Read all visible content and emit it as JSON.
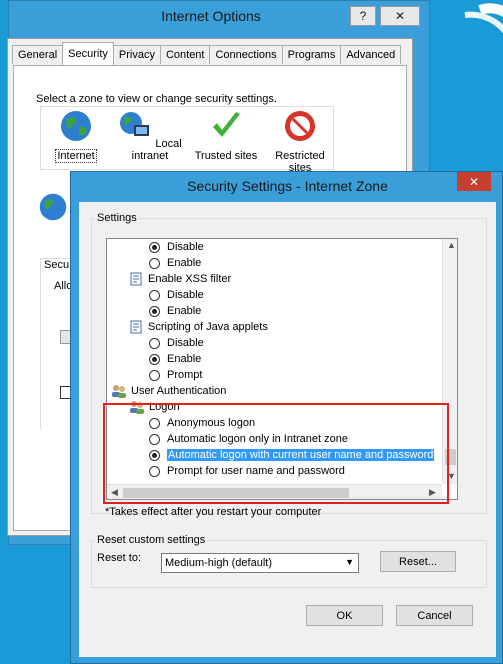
{
  "internet_options": {
    "title": "Internet Options",
    "help_btn": "?",
    "close_btn": "✕",
    "tabs": [
      "General",
      "Security",
      "Privacy",
      "Content",
      "Connections",
      "Programs",
      "Advanced"
    ],
    "zone_prompt": "Select a zone to view or change security settings.",
    "zones": [
      {
        "label": "Internet"
      },
      {
        "label": "Local intranet"
      },
      {
        "label": "Trusted sites"
      },
      {
        "label": "Restricted\nsites"
      }
    ],
    "partial_secu": "Secu",
    "partial_allo": "Allo"
  },
  "security_settings": {
    "title": "Security Settings - Internet Zone",
    "close_btn": "✕",
    "settings_label": "Settings",
    "items": [
      {
        "type": "radio",
        "label": "Disable",
        "checked": true
      },
      {
        "type": "radio",
        "label": "Enable",
        "checked": false
      },
      {
        "type": "category",
        "label": "Enable XSS filter"
      },
      {
        "type": "radio",
        "label": "Disable",
        "checked": false
      },
      {
        "type": "radio",
        "label": "Enable",
        "checked": true
      },
      {
        "type": "category",
        "label": "Scripting of Java applets"
      },
      {
        "type": "radio",
        "label": "Disable",
        "checked": false
      },
      {
        "type": "radio",
        "label": "Enable",
        "checked": true
      },
      {
        "type": "radio",
        "label": "Prompt",
        "checked": false
      },
      {
        "type": "group",
        "label": "User Authentication"
      },
      {
        "type": "subgroup",
        "label": "Logon"
      },
      {
        "type": "radio",
        "label": "Anonymous logon",
        "checked": false
      },
      {
        "type": "radio",
        "label": "Automatic logon only in Intranet zone",
        "checked": false
      },
      {
        "type": "radio",
        "label": "Automatic logon with current user name and password",
        "checked": true,
        "selected": true
      },
      {
        "type": "radio",
        "label": "Prompt for user name and password",
        "checked": false
      }
    ],
    "restart_note": "*Takes effect after you restart your computer",
    "reset_group_label": "Reset custom settings",
    "reset_to_label": "Reset to:",
    "reset_to_value": "Medium-high (default)",
    "reset_button": "Reset...",
    "ok_button": "OK",
    "cancel_button": "Cancel"
  },
  "colors": {
    "desktop": "#1a9ad6",
    "title_bar": "#3a9fd8",
    "highlight_box": "#e0211d",
    "selection": "#3399ff"
  }
}
